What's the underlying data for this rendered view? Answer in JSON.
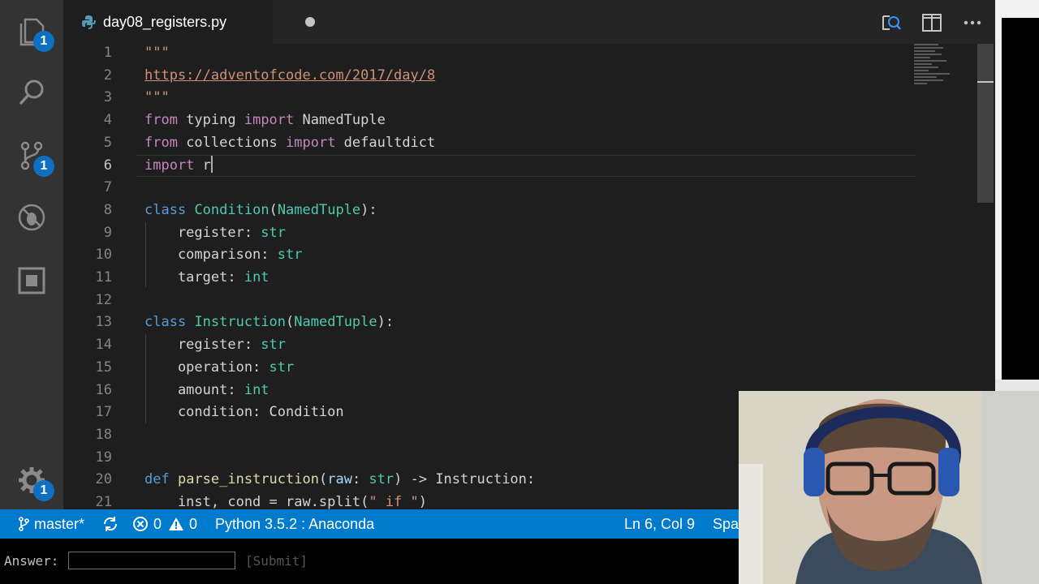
{
  "tab": {
    "filename": "day08_registers.py"
  },
  "editor": {
    "lines": [
      {
        "n": "1",
        "html": "<span class=\"str\">\"\"\"</span>"
      },
      {
        "n": "2",
        "html": "<span class=\"url\">https://adventofcode.com/2017/day/8</span>"
      },
      {
        "n": "3",
        "html": "<span class=\"str\">\"\"\"</span>"
      },
      {
        "n": "4",
        "html": "<span class=\"kw2\">from</span> typing <span class=\"kw2\">import</span> NamedTuple"
      },
      {
        "n": "5",
        "html": "<span class=\"kw2\">from</span> collections <span class=\"kw2\">import</span> defaultdict"
      },
      {
        "n": "6",
        "html": "<span class=\"kw2\">import</span> r<span class=\"caret\"></span>"
      },
      {
        "n": "7",
        "html": ""
      },
      {
        "n": "8",
        "html": "<span class=\"kw\">class</span> <span class=\"cls\">Condition</span>(<span class=\"cls\">NamedTuple</span>):"
      },
      {
        "n": "9",
        "html": "    register: <span class=\"cls\">str</span>"
      },
      {
        "n": "10",
        "html": "    comparison: <span class=\"cls\">str</span>"
      },
      {
        "n": "11",
        "html": "    target: <span class=\"cls\">int</span>"
      },
      {
        "n": "12",
        "html": ""
      },
      {
        "n": "13",
        "html": "<span class=\"kw\">class</span> <span class=\"cls\">Instruction</span>(<span class=\"cls\">NamedTuple</span>):"
      },
      {
        "n": "14",
        "html": "    register: <span class=\"cls\">str</span>"
      },
      {
        "n": "15",
        "html": "    operation: <span class=\"cls\">str</span>"
      },
      {
        "n": "16",
        "html": "    amount: <span class=\"cls\">int</span>"
      },
      {
        "n": "17",
        "html": "    condition: Condition"
      },
      {
        "n": "18",
        "html": ""
      },
      {
        "n": "19",
        "html": ""
      },
      {
        "n": "20",
        "html": "<span class=\"kw\">def</span> <span class=\"fn\">parse_instruction</span>(<span class=\"param\">raw</span>: <span class=\"cls\">str</span>) -&gt; Instruction:"
      },
      {
        "n": "21",
        "html": "    inst, cond = raw.split(<span class=\"str\">\" if \"</span>)"
      }
    ]
  },
  "activity": {
    "explorer_badge": "1",
    "scm_badge": "1",
    "settings_badge": "1"
  },
  "status": {
    "branch": "master*",
    "errors": "0",
    "warnings": "0",
    "interpreter": "Python 3.5.2 : Anaconda",
    "cursor": "Ln 6, Col 9",
    "spaces": "Spa"
  },
  "answer": {
    "label": "Answer:",
    "value": "",
    "submit": "[Submit]"
  },
  "colors": {
    "statusbar": "#007acc",
    "activity_bar": "#333333",
    "editor_bg": "#1e1e1e",
    "badge": "#0e70c0"
  }
}
